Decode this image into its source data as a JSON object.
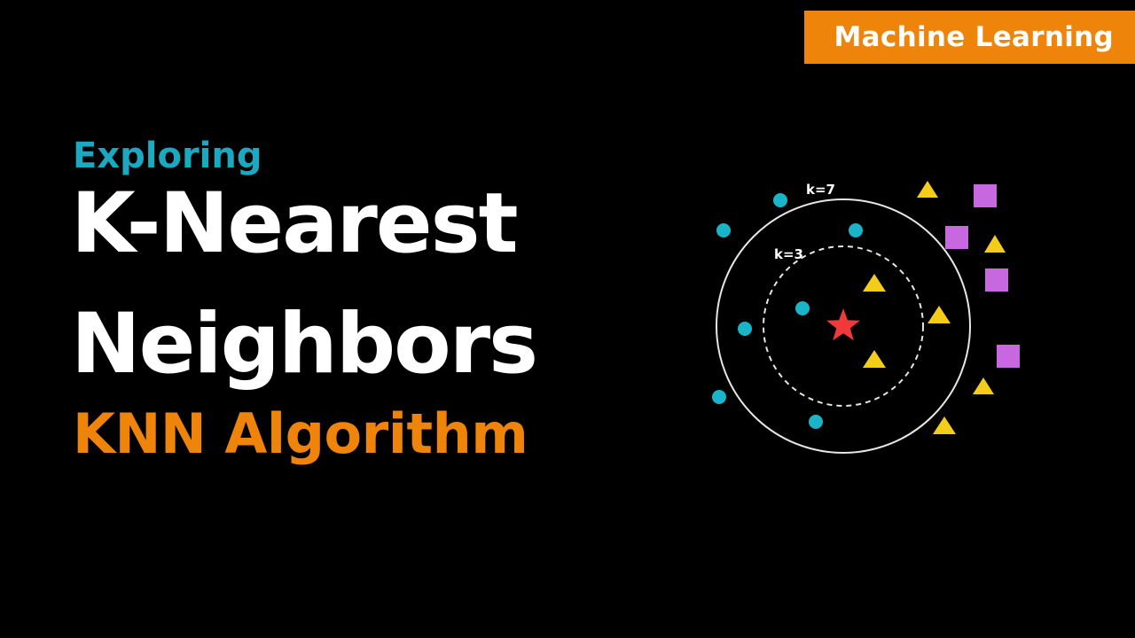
{
  "badge": {
    "label": "Machine Learning"
  },
  "title": {
    "kicker": "Exploring",
    "line1": "K-Nearest",
    "line2": "Neighbors",
    "subtitle": "KNN Algorithm"
  },
  "diagram": {
    "outer_label": "k=7",
    "inner_label": "k=3",
    "query_symbol": "star-icon"
  },
  "colors": {
    "background": "#000000",
    "accent_orange": "#ee8409",
    "accent_teal": "#1aa9c0",
    "circle_class": "#1ab4c8",
    "triangle_class": "#f4cd1a",
    "square_class": "#c868e0",
    "query_point": "#f03a3a"
  }
}
